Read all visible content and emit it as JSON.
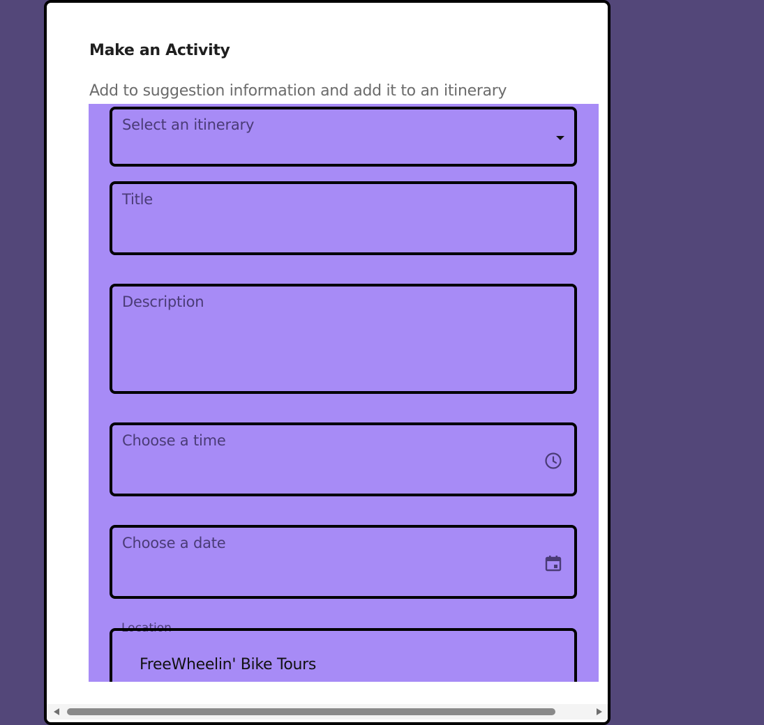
{
  "modal": {
    "title": "Make an Activity",
    "subtitle": "Add to suggestion information and add it to an itinerary"
  },
  "form": {
    "itinerary_select": {
      "placeholder": "Select an itinerary",
      "icon": "dropdown-arrow-icon"
    },
    "title_field": {
      "label": "Title",
      "value": ""
    },
    "description_field": {
      "label": "Description",
      "value": ""
    },
    "time_field": {
      "label": "Choose a time",
      "icon": "clock-icon"
    },
    "date_field": {
      "label": "Choose a date",
      "icon": "calendar-icon"
    },
    "location_field": {
      "label": "Location",
      "value": "FreeWheelin' Bike Tours"
    }
  },
  "colors": {
    "page_background": "#534779",
    "form_background": "#a78bf6",
    "label_color": "#4a3b76"
  }
}
